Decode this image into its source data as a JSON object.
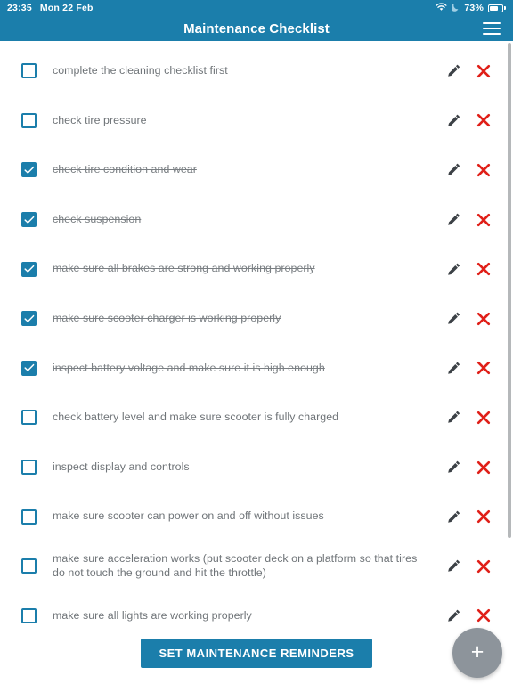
{
  "status_bar": {
    "time": "23:35",
    "date": "Mon 22 Feb",
    "battery_percent": "73%",
    "icons": [
      "wifi-icon",
      "do-not-disturb-moon-icon",
      "battery-icon"
    ]
  },
  "app_bar": {
    "title": "Maintenance Checklist",
    "menu_icon": "hamburger-menu-icon"
  },
  "list": {
    "items": [
      {
        "label": "complete the cleaning checklist first",
        "checked": false
      },
      {
        "label": "check tire pressure",
        "checked": false
      },
      {
        "label": "check tire condition and wear",
        "checked": true
      },
      {
        "label": "check suspension",
        "checked": true
      },
      {
        "label": "make sure all brakes are strong and working properly",
        "checked": true
      },
      {
        "label": "make sure scooter charger is working properly",
        "checked": true
      },
      {
        "label": "inspect battery voltage and make sure it is high enough",
        "checked": true
      },
      {
        "label": "check battery level and make sure scooter is fully charged",
        "checked": false
      },
      {
        "label": "inspect display and controls",
        "checked": false
      },
      {
        "label": "make sure scooter can power on and off without issues",
        "checked": false
      },
      {
        "label": "make sure acceleration works (put scooter deck on a platform so that tires do not touch the ground and hit the throttle)",
        "checked": false
      },
      {
        "label": "make sure all lights are working properly",
        "checked": false
      }
    ],
    "row_edit_icon": "pencil-icon",
    "row_delete_icon": "close-x-icon"
  },
  "fab": {
    "label": "+",
    "icon": "add-plus-icon"
  },
  "cta": {
    "label": "SET MAINTENANCE REMINDERS"
  },
  "colors": {
    "accent": "#1b7eab",
    "delete": "#e01f18",
    "fab": "#8d949b",
    "text": "#6f7478"
  }
}
